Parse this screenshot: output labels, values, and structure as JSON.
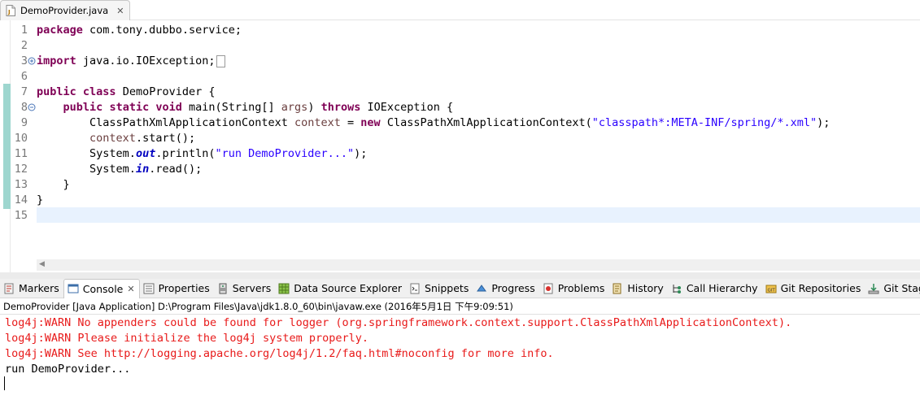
{
  "editor": {
    "tab": {
      "title": "DemoProvider.java",
      "close_glyph": "✕",
      "icon": "java-file-icon"
    },
    "line_numbers": [
      "1",
      "2",
      "3",
      "6",
      "7",
      "8",
      "9",
      "10",
      "11",
      "12",
      "13",
      "14",
      "15"
    ],
    "lines": {
      "l1_kw": "package",
      "l1_rest": " com.tony.dubbo.service;",
      "l3_kw": "import",
      "l3_rest": " java.io.IOException;",
      "l7_kw1": "public",
      "l7_kw2": "class",
      "l7_rest": " DemoProvider {",
      "l8_kw1": "public",
      "l8_kw2": "static",
      "l8_kw3": "void",
      "l8_mid": " main(String[] ",
      "l8_var": "args",
      "l8_p": ") ",
      "l8_kw4": "throws",
      "l8_rest": " IOException {",
      "l9_a": "ClassPathXmlApplicationContext ",
      "l9_var": "context",
      "l9_b": " = ",
      "l9_kw": "new",
      "l9_c": " ClassPathXmlApplicationContext(",
      "l9_str": "\"classpath*:META-INF/spring/*.xml\"",
      "l9_d": ");",
      "l10_var": "context",
      "l10_rest": ".start();",
      "l11_a": "System.",
      "l11_fld": "out",
      "l11_b": ".println(",
      "l11_str": "\"run DemoProvider...\"",
      "l11_c": ");",
      "l12_a": "System.",
      "l12_fld": "in",
      "l12_b": ".read();",
      "l13": "}",
      "l14": "}"
    },
    "colors": {
      "keyword": "#7f0055",
      "string": "#2a00ff",
      "field": "#0000c0",
      "local_var": "#6a3e3e",
      "current_line": "#e8f2fe",
      "change_bar": "#9ed6cf"
    }
  },
  "views": {
    "tabs": [
      {
        "label": "Markers",
        "icon": "markers-icon"
      },
      {
        "label": "Console",
        "icon": "console-icon",
        "active": true,
        "close_glyph": "✕"
      },
      {
        "label": "Properties",
        "icon": "properties-icon"
      },
      {
        "label": "Servers",
        "icon": "servers-icon"
      },
      {
        "label": "Data Source Explorer",
        "icon": "data-source-icon"
      },
      {
        "label": "Snippets",
        "icon": "snippets-icon"
      },
      {
        "label": "Progress",
        "icon": "progress-icon"
      },
      {
        "label": "Problems",
        "icon": "problems-icon"
      },
      {
        "label": "History",
        "icon": "history-icon"
      },
      {
        "label": "Call Hierarchy",
        "icon": "call-hierarchy-icon"
      },
      {
        "label": "Git Repositories",
        "icon": "git-repositories-icon"
      },
      {
        "label": "Git Staging",
        "icon": "git-staging-icon"
      }
    ]
  },
  "console": {
    "header": "DemoProvider [Java Application] D:\\Program Files\\Java\\jdk1.8.0_60\\bin\\javaw.exe (2016年5月1日 下午9:09:51)",
    "output": [
      "log4j:WARN No appenders could be found for logger (org.springframework.context.support.ClassPathXmlApplicationContext).",
      "log4j:WARN Please initialize the log4j system properly.",
      "log4j:WARN See http://logging.apache.org/log4j/1.2/faq.html#noconfig for more info.",
      "run DemoProvider..."
    ],
    "colors": {
      "stderr": "#e81a1a",
      "stdout": "#000000"
    }
  }
}
